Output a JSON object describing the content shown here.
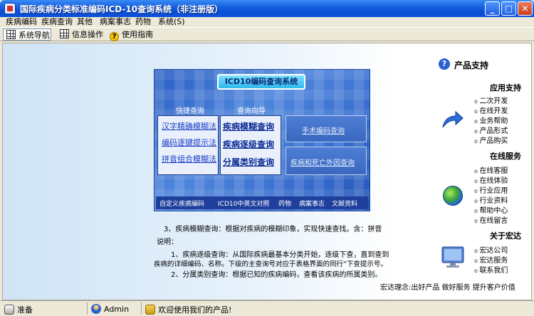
{
  "window": {
    "title": "国际疾病分类标准编码ICD-10查询系统（非注册版）",
    "min": "_",
    "max": "□",
    "close": "✕"
  },
  "menu": [
    "疾病编码",
    "疾病查询",
    "其他",
    "病案事志",
    "药物",
    "系统(S)"
  ],
  "toolbar": {
    "nav": "系统导航",
    "info": "信息操作",
    "guide": "使用指南"
  },
  "panel": {
    "title": "ICD10编码查询系统",
    "quick_label": "快捷查询",
    "wizard_label": "查询向导",
    "quick_links": [
      "汉字精确模糊法",
      "编码逐键提示法",
      "拼音组合模糊法"
    ],
    "main_links": [
      "疾病模糊查询",
      "疾病逐级查询",
      "分属类别查询"
    ],
    "manual": "手术编码查询",
    "manual2": "疾病和死亡外因查询",
    "bottom": [
      "自定义疾病编码",
      "ICD10中英文对照",
      "药物",
      "病案事志",
      "文献资料"
    ]
  },
  "description": [
    "3、疾病模糊查询：根据对疾病的模糊印象，实现快速查找。含：拼音",
    "说明：",
    "1、疾病逐级查询：从国际疾病最基本分类开始，逐级下查，直到查到",
    "疾病的详细编码、名称。下级的主查询号对应于表格界面的同行“下查提示号。",
    "2、分属类别查询：根据已知的疾病编码，查看该疾病的所属类别。"
  ],
  "sidebar": {
    "product_support": "产品支持",
    "app_support": "应用支持",
    "app_links": [
      "二次开发",
      "在线开发",
      "业务帮助",
      "产品形式",
      "产品购买"
    ],
    "online_service": "在线服务",
    "online_links": [
      "在线客服",
      "在线体验",
      "行业应用",
      "行业资料",
      "帮助中心",
      "在线留言"
    ],
    "about": "关于宏达",
    "about_links": [
      "宏达公司",
      "宏达服务",
      "联系我们"
    ],
    "motto": "宏达理念:出好产品 做好服务 提升客户价值"
  },
  "status": {
    "ready": "准备",
    "user": "Admin",
    "message": "欢迎使用我们的产品!"
  }
}
